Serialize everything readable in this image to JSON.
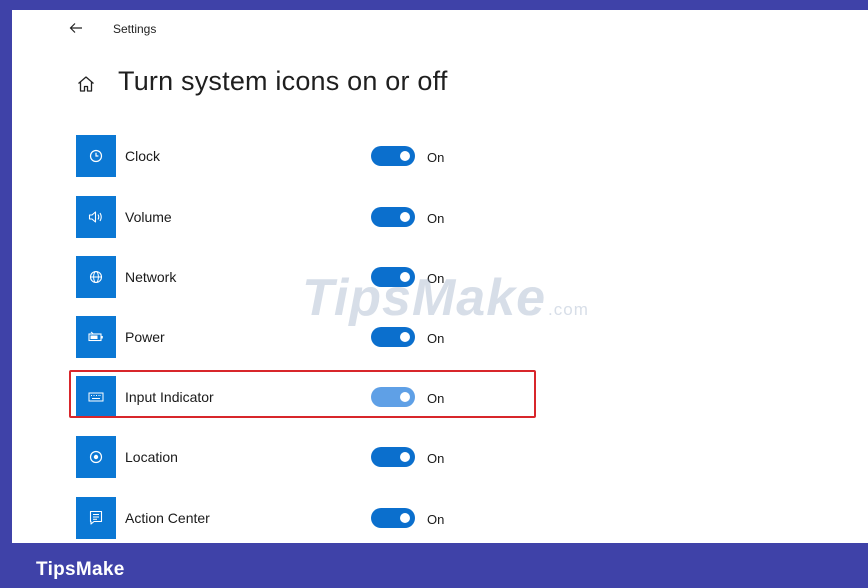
{
  "window": {
    "title": "Settings"
  },
  "page": {
    "title": "Turn system icons on or off"
  },
  "items": [
    {
      "label": "Clock",
      "icon": "clock-icon",
      "state": "On",
      "on": true
    },
    {
      "label": "Volume",
      "icon": "volume-icon",
      "state": "On",
      "on": true
    },
    {
      "label": "Network",
      "icon": "network-icon",
      "state": "On",
      "on": true
    },
    {
      "label": "Power",
      "icon": "battery-icon",
      "state": "On",
      "on": true
    },
    {
      "label": "Input Indicator",
      "icon": "keyboard-icon",
      "state": "On",
      "on": true,
      "highlighted": true
    },
    {
      "label": "Location",
      "icon": "location-icon",
      "state": "On",
      "on": true
    },
    {
      "label": "Action Center",
      "icon": "action-center-icon",
      "state": "On",
      "on": true
    }
  ],
  "watermark": {
    "text": "TipsMake",
    "suffix": ".com"
  },
  "footer": {
    "brand": "TipsMake"
  },
  "colors": {
    "accent": "#0b78d4",
    "toggle_on": "#0b6fcd",
    "highlight": "#d8262b",
    "border": "#3f42a8"
  }
}
